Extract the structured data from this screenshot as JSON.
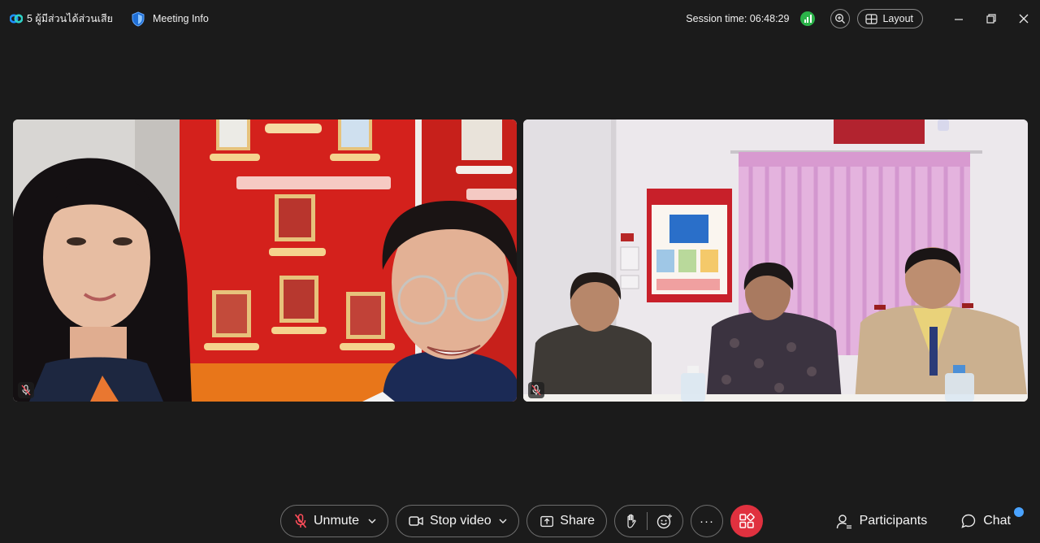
{
  "header": {
    "meeting_name": "5 ผู้มีส่วนได้ส่วนเสีย",
    "meeting_info_label": "Meeting Info",
    "session_time": "Session time: 06:48:29",
    "layout_label": "Layout"
  },
  "colors": {
    "background": "#1b1b1b",
    "signal_good": "#2bb34a",
    "end_meeting": "#e0313f",
    "notification_dot": "#4aa3ff"
  },
  "controls": {
    "unmute_label": "Unmute",
    "stop_video_label": "Stop video",
    "share_label": "Share",
    "more_label": "···"
  },
  "panel": {
    "participants_label": "Participants",
    "chat_label": "Chat"
  }
}
